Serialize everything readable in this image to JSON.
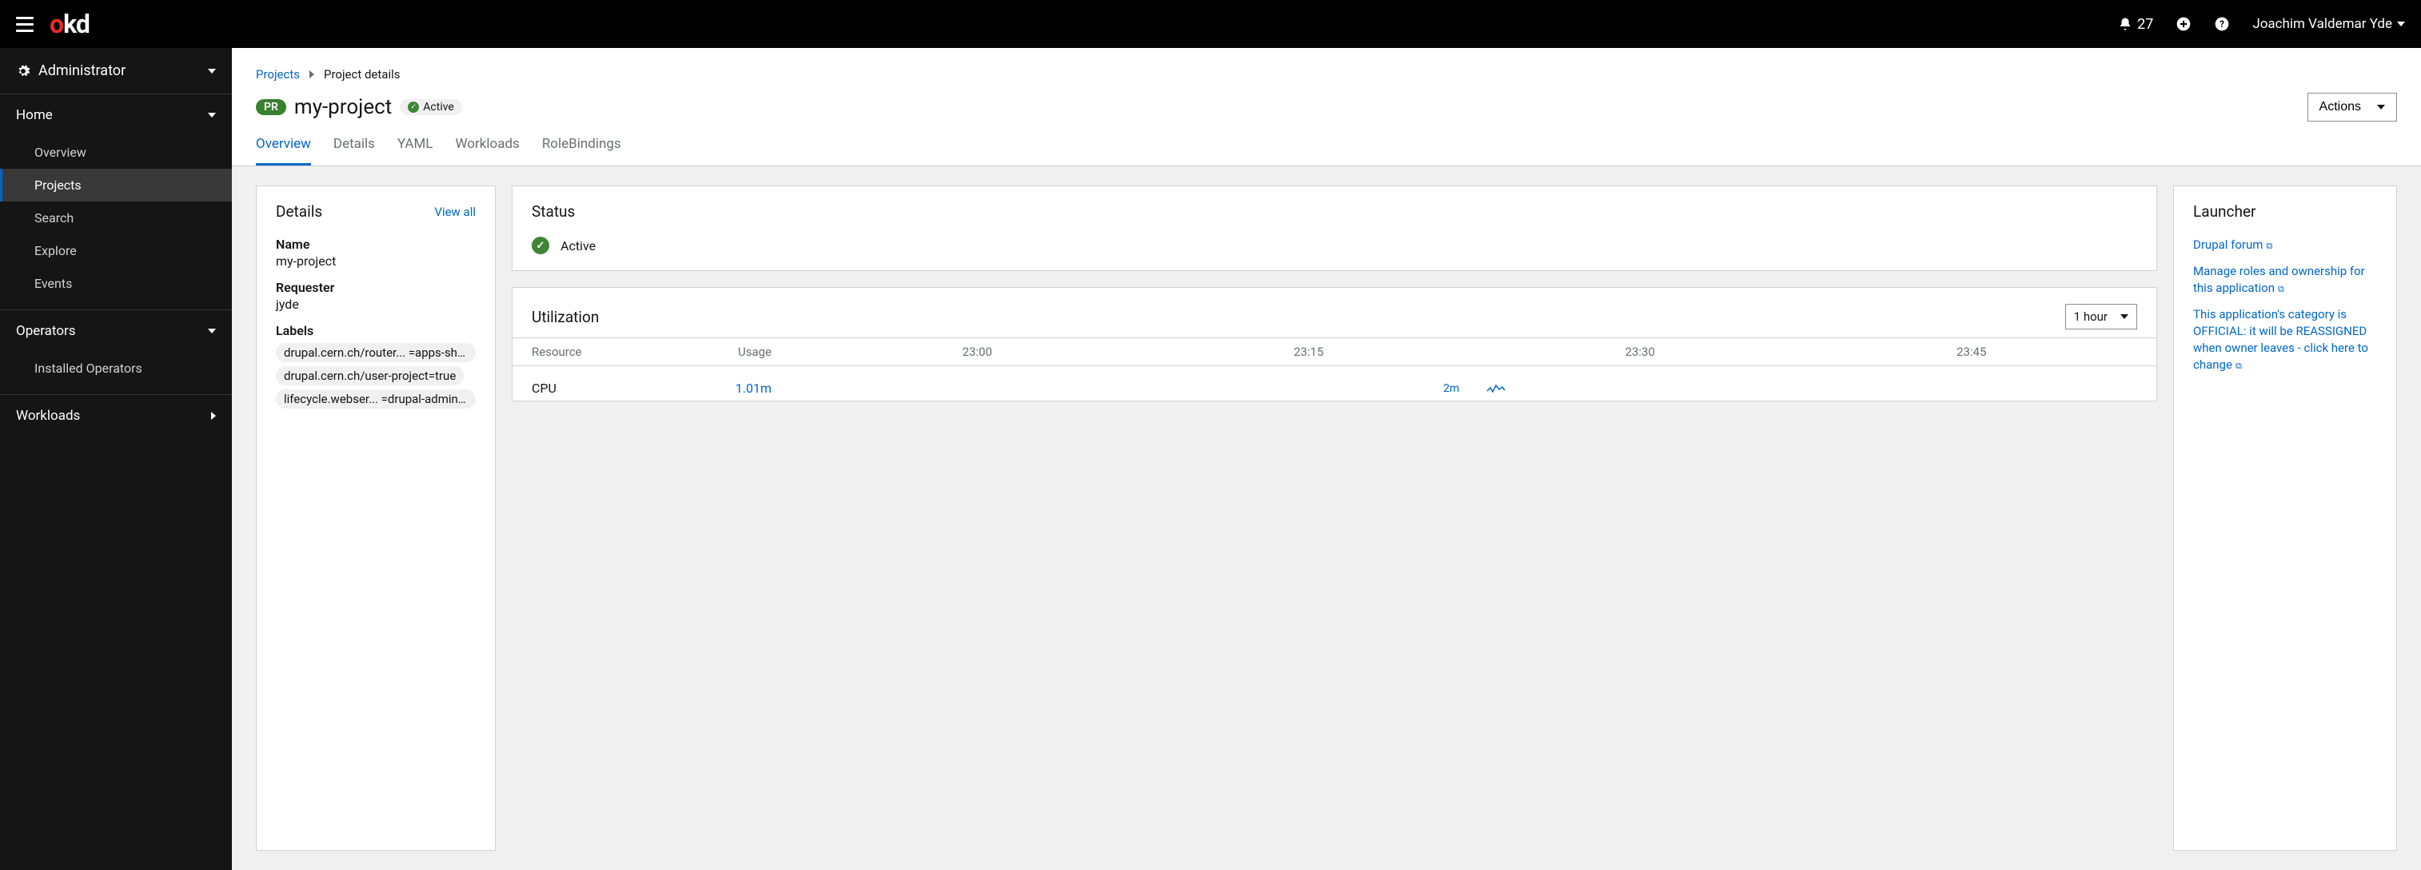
{
  "topbar": {
    "logo_o": "o",
    "logo_kd": "kd",
    "notif_count": "27",
    "username": "Joachim Valdemar Yde"
  },
  "sidebar": {
    "perspective": "Administrator",
    "sections": [
      {
        "label": "Home",
        "expanded": true,
        "items": [
          "Overview",
          "Projects",
          "Search",
          "Explore",
          "Events"
        ],
        "active_index": 1
      },
      {
        "label": "Operators",
        "expanded": true,
        "items": [
          "Installed Operators"
        ],
        "active_index": -1
      },
      {
        "label": "Workloads",
        "expanded": false,
        "items": [],
        "active_index": -1
      }
    ]
  },
  "breadcrumb": {
    "root": "Projects",
    "current": "Project details"
  },
  "project": {
    "badge": "PR",
    "name": "my-project",
    "status": "Active",
    "actions_label": "Actions"
  },
  "tabs": [
    "Overview",
    "Details",
    "YAML",
    "Workloads",
    "RoleBindings"
  ],
  "details_card": {
    "title": "Details",
    "view_all": "View all",
    "name_label": "Name",
    "name_value": "my-project",
    "requester_label": "Requester",
    "requester_value": "jyde",
    "labels_label": "Labels",
    "labels": [
      "drupal.cern.ch/router... =apps-sha...",
      "drupal.cern.ch/user-project=true",
      "lifecycle.webser... =drupal-admins..."
    ]
  },
  "status_card": {
    "title": "Status",
    "value": "Active"
  },
  "utilization_card": {
    "title": "Utilization",
    "range": "1 hour",
    "head_resource": "Resource",
    "head_usage": "Usage",
    "times": [
      "23:00",
      "23:15",
      "23:30",
      "23:45"
    ],
    "rows": [
      {
        "resource": "CPU",
        "usage": "1.01m",
        "graph_text": "2m"
      }
    ]
  },
  "launcher_card": {
    "title": "Launcher",
    "links": [
      "Drupal forum",
      "Manage roles and ownership for this application",
      "This application's category is OFFICIAL: it will be REASSIGNED when owner leaves - click here to change"
    ]
  }
}
